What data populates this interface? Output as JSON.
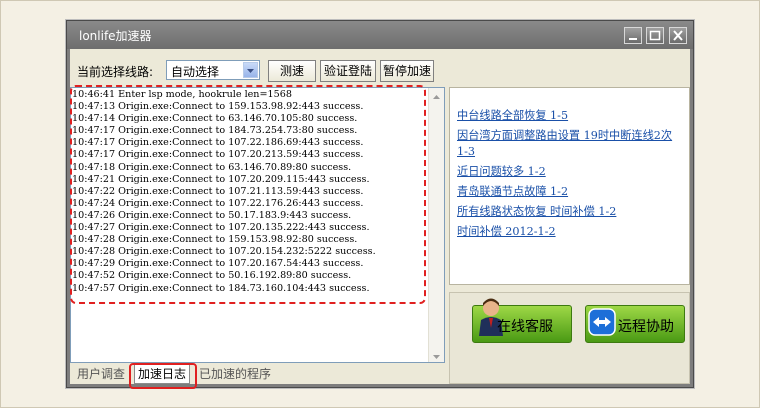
{
  "window": {
    "title": "lonlife加速器"
  },
  "toolbar": {
    "route_label": "当前选择线路:",
    "route_value": "自动选择",
    "speed_test_label": "测速",
    "verify_login_label": "验证登陆",
    "pause_label": "暂停加速"
  },
  "log": {
    "lines": [
      "10:46:41 Enter lsp mode, hookrule len=1568",
      "10:47:13 Origin.exe:Connect to 159.153.98.92:443 success.",
      "10:47:14 Origin.exe:Connect to 63.146.70.105:80 success.",
      "10:47:17 Origin.exe:Connect to 184.73.254.73:80 success.",
      "10:47:17 Origin.exe:Connect to 107.22.186.69:443 success.",
      "10:47:17 Origin.exe:Connect to 107.20.213.59:443 success.",
      "10:47:18 Origin.exe:Connect to 63.146.70.89:80 success.",
      "10:47:21 Origin.exe:Connect to 107.20.209.115:443 success.",
      "10:47:22 Origin.exe:Connect to 107.21.113.59:443 success.",
      "10:47:24 Origin.exe:Connect to 107.22.176.26:443 success.",
      "10:47:26 Origin.exe:Connect to 50.17.183.9:443 success.",
      "10:47:27 Origin.exe:Connect to 107.20.135.222:443 success.",
      "10:47:28 Origin.exe:Connect to 159.153.98.92:80 success.",
      "10:47:28 Origin.exe:Connect to 107.20.154.232:5222 success.",
      "10:47:29 Origin.exe:Connect to 107.20.167.54:443 success.",
      "10:47:52 Origin.exe:Connect to 50.16.192.89:80 success.",
      "10:47:57 Origin.exe:Connect to 184.73.160.104:443 success."
    ]
  },
  "tabs": [
    {
      "label": "用户调查"
    },
    {
      "label": "加速日志"
    },
    {
      "label": "已加速的程序"
    }
  ],
  "news": [
    {
      "text": "中台线路全部恢复 1-5"
    },
    {
      "text": "因台湾方面调整路由设置 19时中断连线2次"
    },
    {
      "text": "1-3"
    },
    {
      "text": "近日问题较多 1-2"
    },
    {
      "text": "青岛联通节点故障 1-2"
    },
    {
      "text": "所有线路状态恢复 时间补偿 1-2"
    },
    {
      "text": "时间补偿 2012-1-2"
    }
  ],
  "support": {
    "online_service_label": "在线客服",
    "remote_assist_label": "远程协助"
  },
  "colors": {
    "link": "#1a50a8",
    "highlight": "#e02020",
    "green_button": "#6cbf2a"
  }
}
